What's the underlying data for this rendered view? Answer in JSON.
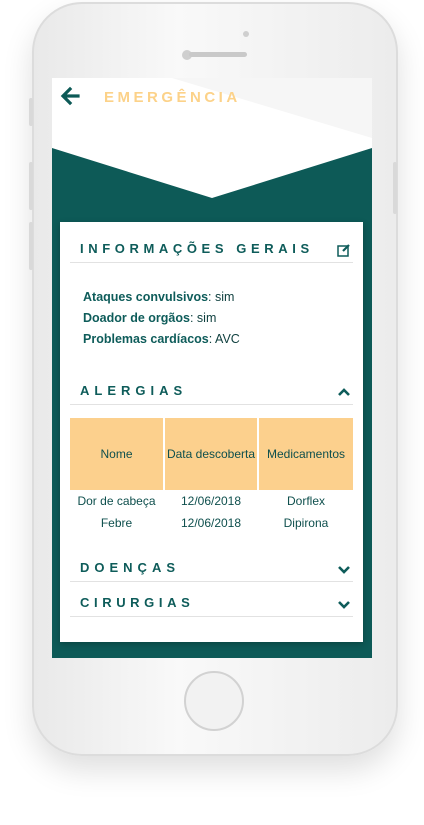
{
  "app": {
    "title": "EMERGÊNCIA"
  },
  "colors": {
    "primary": "#0e5c5a",
    "accent": "#fcd289",
    "table_header": "#fcd08d"
  },
  "general_info": {
    "title": "INFORMAÇÕES GERAIS",
    "items": [
      {
        "label": "Ataques convulsivos",
        "value": "sim"
      },
      {
        "label": "Doador de orgãos",
        "value": "sim"
      },
      {
        "label": "Problemas cardíacos",
        "value": "AVC"
      }
    ]
  },
  "allergies": {
    "title": "ALERGIAS",
    "columns": [
      "Nome",
      "Data descoberta",
      "Medicamentos"
    ],
    "rows": [
      [
        "Dor de cabeça",
        "12/06/2018",
        "Dorflex"
      ],
      [
        "Febre",
        "12/06/2018",
        "Dipirona"
      ]
    ]
  },
  "diseases": {
    "title": "DOENÇAS"
  },
  "surgeries": {
    "title": "CIRURGIAS"
  },
  "icons": {
    "back": "arrow-left-icon",
    "edit": "edit-icon",
    "collapse": "chevron-up-icon",
    "expand": "chevron-down-icon"
  }
}
